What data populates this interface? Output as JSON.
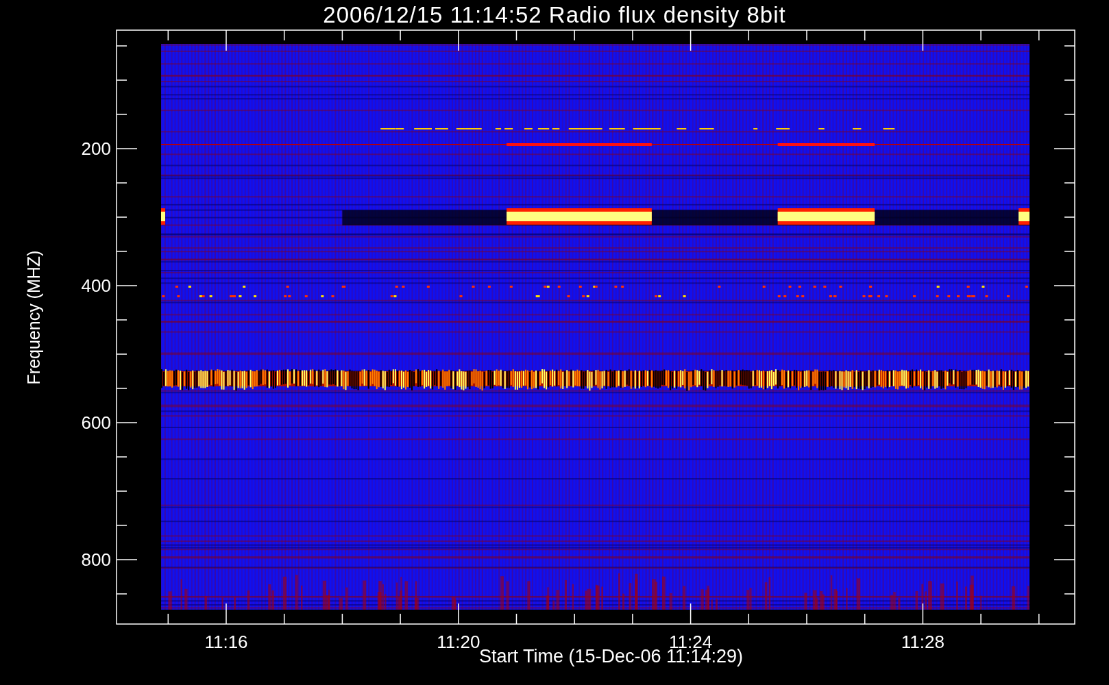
{
  "title": "2006/12/15 11:14:52 Radio flux density 8bit",
  "y_axis": {
    "label": "Frequency (MHZ)",
    "ticks": [
      "200",
      "400",
      "600",
      "800"
    ]
  },
  "x_axis": {
    "label": "Start Time (15-Dec-06 11:14:29)",
    "ticks": [
      "11:16",
      "11:20",
      "11:24",
      "11:28"
    ]
  }
}
